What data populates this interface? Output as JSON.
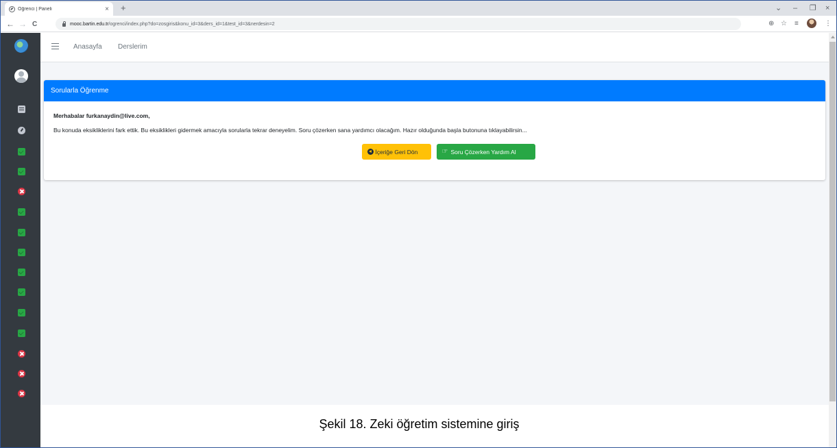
{
  "browser": {
    "tab_title": "Öğrenci | Paneli",
    "tab_close": "×",
    "new_tab": "+",
    "url_host": "mooc.bartin.edu.tr",
    "url_path": "/ogrenci/index.php?do=zosgiris&konu_id=3&ders_id=1&test_id=3&nerdesin=2",
    "back": "←",
    "forward": "→",
    "reload": "C",
    "zoom_icon": "⊕",
    "star_icon": "☆",
    "queue_icon": "≡",
    "menu_icon": "⋮",
    "minimize": "–",
    "restore": "❐",
    "close": "×",
    "dropdown": "⌄"
  },
  "nav": {
    "home": "Anasayfa",
    "courses": "Derslerim"
  },
  "sidebar": {
    "items": [
      "book-icon",
      "gauge-icon",
      "check",
      "check",
      "cross",
      "check",
      "check",
      "check",
      "check",
      "check",
      "check",
      "check",
      "cross",
      "cross",
      "cross"
    ]
  },
  "card": {
    "title": "Sorularla Öğrenme",
    "greeting": "Merhabalar furkanaydin@live.com,",
    "message": "Bu konuda eksikliklerini fark ettik. Bu eksiklikleri gidermek amacıyla sorularla tekrar deneyelim. Soru çözerken sana yardımcı olacağım. Hazır olduğunda başla butonuna tıklayabilirsin...",
    "back_button": "İçeriğe Geri Dön",
    "help_button": "Soru Çözerken Yardım Al"
  },
  "caption": "Şekil 18. Zeki öğretim sistemine giriş",
  "colors": {
    "primary": "#007bff",
    "warning": "#ffc107",
    "success": "#28a745",
    "danger": "#dc3545",
    "sidebar": "#343a40"
  }
}
